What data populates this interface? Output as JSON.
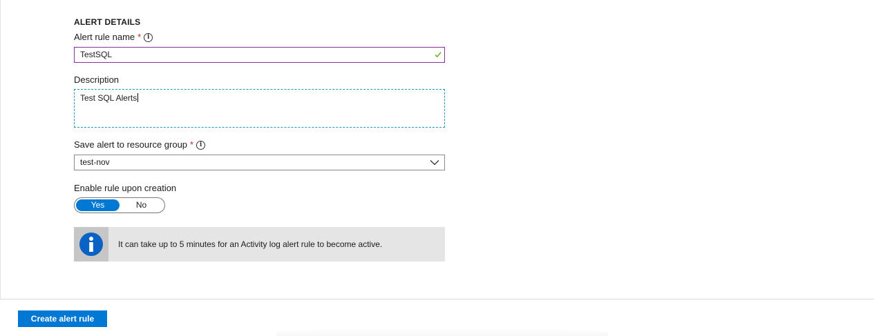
{
  "section": {
    "title": "ALERT DETAILS"
  },
  "alert_rule_name": {
    "label": "Alert rule name",
    "required_marker": "*",
    "value": "TestSQL",
    "valid": true
  },
  "description": {
    "label": "Description",
    "value": "Test SQL Alerts"
  },
  "resource_group": {
    "label": "Save alert to resource group",
    "required_marker": "*",
    "selected": "test-nov"
  },
  "enable_rule": {
    "label": "Enable rule upon creation",
    "options": [
      "Yes",
      "No"
    ],
    "selected": "Yes"
  },
  "info_message": {
    "text": "It can take up to 5 minutes for an Activity log alert rule to become active."
  },
  "footer": {
    "create_button_label": "Create alert rule"
  },
  "colors": {
    "accent": "#0078d4",
    "valid_check": "#57a300",
    "required": "#c4262e",
    "name_field_border": "#8a2da5",
    "description_border": "#1a9ab8"
  },
  "icons": {
    "info": "info-icon",
    "valid": "check-icon",
    "dropdown": "chevron-down-icon",
    "info_banner": "info-circle-icon"
  }
}
